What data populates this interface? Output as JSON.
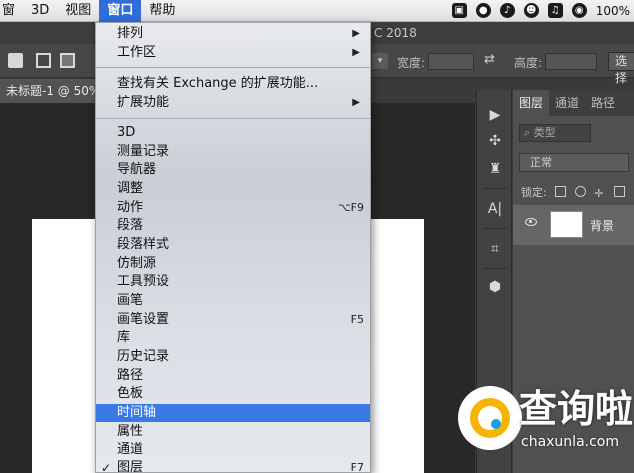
{
  "menubar": {
    "items": [
      {
        "label": "窗",
        "active": false
      },
      {
        "label": "3D",
        "active": false
      },
      {
        "label": "视图",
        "active": false
      },
      {
        "label": "窗口",
        "active": true
      },
      {
        "label": "帮助",
        "active": false
      }
    ],
    "status_icons": [
      "app-icon",
      "wechat-icon",
      "bell-icon",
      "qq-icon",
      "mic-icon",
      "wifi-icon"
    ],
    "battery": "100%"
  },
  "app": {
    "title": "C 2018",
    "doc_tab": "未标题-1 @ 50%"
  },
  "options_bar": {
    "width_label": "宽度:",
    "height_label": "高度:",
    "select_button": "选择"
  },
  "panel": {
    "tabs": [
      "图层",
      "通道",
      "路径"
    ],
    "filter_label": "类型",
    "blend_mode": "正常",
    "lock_label": "锁定:",
    "layer_name": "背景"
  },
  "window_menu": {
    "items": [
      {
        "label": "排列",
        "submenu": true,
        "shortcut": "",
        "checked": false,
        "highlighted": false
      },
      {
        "label": "工作区",
        "submenu": true,
        "shortcut": "",
        "checked": false,
        "highlighted": false
      },
      {
        "label": "查找有关 Exchange 的扩展功能...",
        "submenu": false,
        "shortcut": "",
        "checked": false,
        "highlighted": false
      },
      {
        "label": "扩展功能",
        "submenu": true,
        "shortcut": "",
        "checked": false,
        "highlighted": false
      },
      {
        "label": "3D",
        "submenu": false,
        "shortcut": "",
        "checked": false,
        "highlighted": false
      },
      {
        "label": "测量记录",
        "submenu": false,
        "shortcut": "",
        "checked": false,
        "highlighted": false
      },
      {
        "label": "导航器",
        "submenu": false,
        "shortcut": "",
        "checked": false,
        "highlighted": false
      },
      {
        "label": "调整",
        "submenu": false,
        "shortcut": "",
        "checked": false,
        "highlighted": false
      },
      {
        "label": "动作",
        "submenu": false,
        "shortcut": "⌥F9",
        "checked": false,
        "highlighted": false
      },
      {
        "label": "段落",
        "submenu": false,
        "shortcut": "",
        "checked": false,
        "highlighted": false
      },
      {
        "label": "段落样式",
        "submenu": false,
        "shortcut": "",
        "checked": false,
        "highlighted": false
      },
      {
        "label": "仿制源",
        "submenu": false,
        "shortcut": "",
        "checked": false,
        "highlighted": false
      },
      {
        "label": "工具预设",
        "submenu": false,
        "shortcut": "",
        "checked": false,
        "highlighted": false
      },
      {
        "label": "画笔",
        "submenu": false,
        "shortcut": "",
        "checked": false,
        "highlighted": false
      },
      {
        "label": "画笔设置",
        "submenu": false,
        "shortcut": "F5",
        "checked": false,
        "highlighted": false
      },
      {
        "label": "库",
        "submenu": false,
        "shortcut": "",
        "checked": false,
        "highlighted": false
      },
      {
        "label": "历史记录",
        "submenu": false,
        "shortcut": "",
        "checked": false,
        "highlighted": false
      },
      {
        "label": "路径",
        "submenu": false,
        "shortcut": "",
        "checked": false,
        "highlighted": false
      },
      {
        "label": "色板",
        "submenu": false,
        "shortcut": "",
        "checked": false,
        "highlighted": false
      },
      {
        "label": "时间轴",
        "submenu": false,
        "shortcut": "",
        "checked": false,
        "highlighted": true
      },
      {
        "label": "属性",
        "submenu": false,
        "shortcut": "",
        "checked": false,
        "highlighted": false
      },
      {
        "label": "通道",
        "submenu": false,
        "shortcut": "",
        "checked": false,
        "highlighted": false
      },
      {
        "label": "图层",
        "submenu": false,
        "shortcut": "F7",
        "checked": true,
        "highlighted": false
      }
    ]
  },
  "watermark": {
    "text": "查询啦",
    "url": "chaxunla.com"
  },
  "colors": {
    "menu_highlight": "#3a78e4",
    "menubar_active": "#2f6ddb",
    "watermark_yellow": "#f6b400",
    "watermark_blue": "#1a9ee0"
  }
}
